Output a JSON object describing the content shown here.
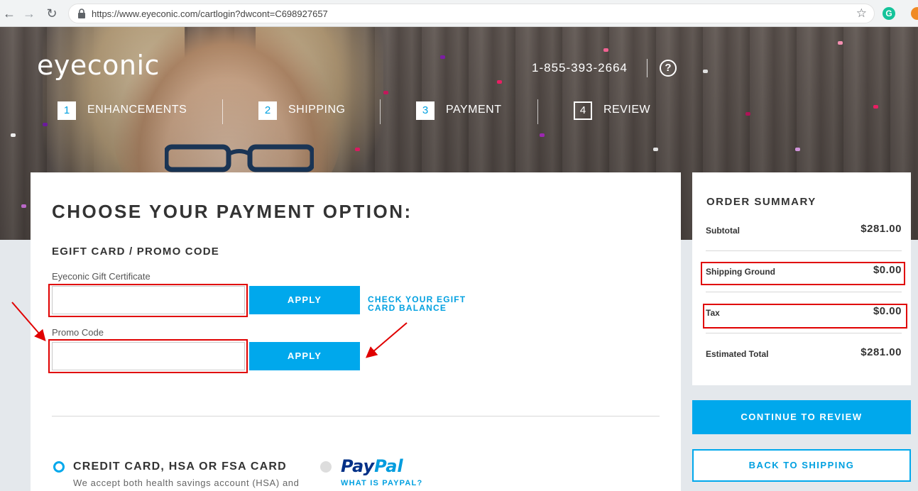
{
  "browser": {
    "url": "https://www.eyeconic.com/cartlogin?dwcont=C698927657",
    "back_icon": "arrow-left-icon",
    "forward_icon": "arrow-right-icon",
    "reload_icon": "reload-icon",
    "extension_letter": "G"
  },
  "header": {
    "logo_text": "eyeconic",
    "phone": "1-855-393-2664",
    "help_glyph": "?"
  },
  "steps": [
    {
      "number": "1",
      "label": "ENHANCEMENTS"
    },
    {
      "number": "2",
      "label": "SHIPPING"
    },
    {
      "number": "3",
      "label": "PAYMENT"
    },
    {
      "number": "4",
      "label": "REVIEW"
    }
  ],
  "payment": {
    "title": "CHOOSE YOUR PAYMENT OPTION:",
    "egift_section_title": "EGIFT CARD / PROMO CODE",
    "gift_label": "Eyeconic Gift Certificate",
    "gift_value": "",
    "promo_label": "Promo Code",
    "promo_value": "",
    "apply_label": "APPLY",
    "check_balance_link": "CHECK YOUR EGIFT CARD BALANCE",
    "credit_card_label": "CREDIT CARD, HSA OR FSA CARD",
    "credit_card_desc": "We accept both health savings account (HSA) and",
    "paypal_logo_part1": "Pay",
    "paypal_logo_part2": "Pal",
    "paypal_link": "WHAT IS PAYPAL?"
  },
  "summary": {
    "title": "ORDER SUMMARY",
    "rows": [
      {
        "label": "Subtotal",
        "value": "$281.00"
      },
      {
        "label": "Shipping Ground",
        "value": "$0.00"
      },
      {
        "label": "Tax",
        "value": "$0.00"
      },
      {
        "label": "Estimated Total",
        "value": "$281.00"
      }
    ]
  },
  "actions": {
    "continue_label": "CONTINUE TO REVIEW",
    "back_label": "BACK TO SHIPPING"
  },
  "colors": {
    "accent": "#00a8ec",
    "annotation": "#e00000",
    "paypal_dark": "#003087",
    "paypal_light": "#009cde"
  }
}
